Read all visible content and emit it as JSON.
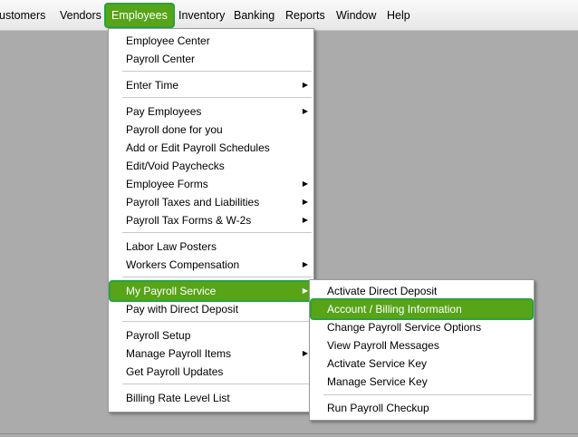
{
  "menubar": {
    "items": [
      "ustomers",
      "Vendors",
      "Employees",
      "Inventory",
      "Banking",
      "Reports",
      "Window",
      "Help"
    ]
  },
  "employees_menu": {
    "items": {
      "employee_center": "Employee Center",
      "payroll_center": "Payroll Center",
      "enter_time": "Enter Time",
      "pay_employees": "Pay Employees",
      "payroll_done_for_you": "Payroll done for you",
      "payroll_schedules": "Add or Edit Payroll Schedules",
      "edit_void_paychecks": "Edit/Void Paychecks",
      "employee_forms": "Employee Forms",
      "payroll_taxes": "Payroll Taxes and Liabilities",
      "payroll_tax_forms": "Payroll Tax Forms & W-2s",
      "labor_law_posters": "Labor Law Posters",
      "workers_comp": "Workers Compensation",
      "my_payroll_service": "My Payroll Service",
      "pay_direct_deposit": "Pay with Direct Deposit",
      "payroll_setup": "Payroll Setup",
      "manage_payroll_items": "Manage Payroll Items",
      "get_payroll_updates": "Get Payroll Updates",
      "billing_rate_level_list": "Billing Rate Level List"
    }
  },
  "payroll_service_submenu": {
    "items": {
      "activate_direct_deposit": "Activate Direct Deposit",
      "account_billing": "Account / Billing Information",
      "change_options": "Change Payroll Service Options",
      "view_messages": "View Payroll Messages",
      "activate_service_key": "Activate Service Key",
      "manage_service_key": "Manage Service Key",
      "run_checkup": "Run Payroll Checkup"
    }
  },
  "colors": {
    "highlight": "#58a419",
    "highlight_outline": "#27a33c",
    "background": "#ababab"
  },
  "icons": {
    "submenu_arrow": "triangle-right-icon"
  }
}
